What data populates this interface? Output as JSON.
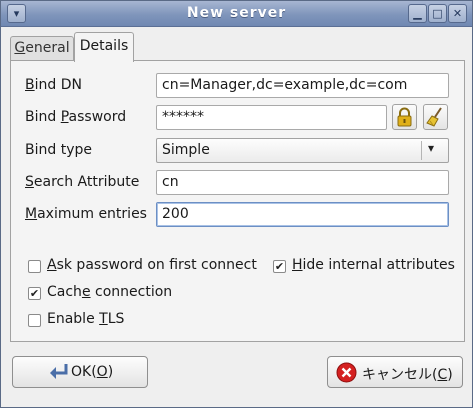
{
  "window": {
    "title": "New server"
  },
  "tabs": [
    {
      "label": "General",
      "mnemonic": "G",
      "rest": "eneral"
    },
    {
      "label": "Details"
    }
  ],
  "form": {
    "bind_dn": {
      "label_pre": "",
      "label_mn": "B",
      "label_post": "ind DN",
      "value": "cn=Manager,dc=example,dc=com"
    },
    "bind_password": {
      "label_pre": "Bind ",
      "label_mn": "P",
      "label_post": "assword",
      "value": "******"
    },
    "bind_type": {
      "label": "Bind type",
      "value": "Simple"
    },
    "search_attribute": {
      "label_pre": "",
      "label_mn": "S",
      "label_post": "earch Attribute",
      "value": "cn"
    },
    "maximum_entries": {
      "label_pre": "",
      "label_mn": "M",
      "label_post": "aximum entries",
      "value": "200"
    }
  },
  "options": {
    "ask_password": {
      "label_pre": "",
      "label_mn": "A",
      "label_post": "sk password on first connect",
      "checked": false
    },
    "hide_internal": {
      "label_pre": "",
      "label_mn": "H",
      "label_post": "ide internal attributes",
      "checked": true
    },
    "cache_connection": {
      "label_pre": "Cach",
      "label_mn": "e",
      "label_post": " connection",
      "checked": true
    },
    "enable_tls": {
      "label_pre": "Enable ",
      "label_mn": "T",
      "label_post": "LS",
      "checked": false
    }
  },
  "buttons": {
    "ok": {
      "label_pre": "OK(",
      "label_mn": "O",
      "label_post": ")"
    },
    "cancel": {
      "label_pre": "キャンセル(",
      "label_mn": "C",
      "label_post": ")"
    }
  },
  "icons": {
    "lock": "lock-icon",
    "broom": "broom-icon",
    "ok": "enter-arrow-icon",
    "cancel": "cancel-circle-icon"
  },
  "colors": {
    "titlebar": "#7f95bb",
    "cancel_red": "#d42020",
    "lock_gold": "#e0b019"
  }
}
